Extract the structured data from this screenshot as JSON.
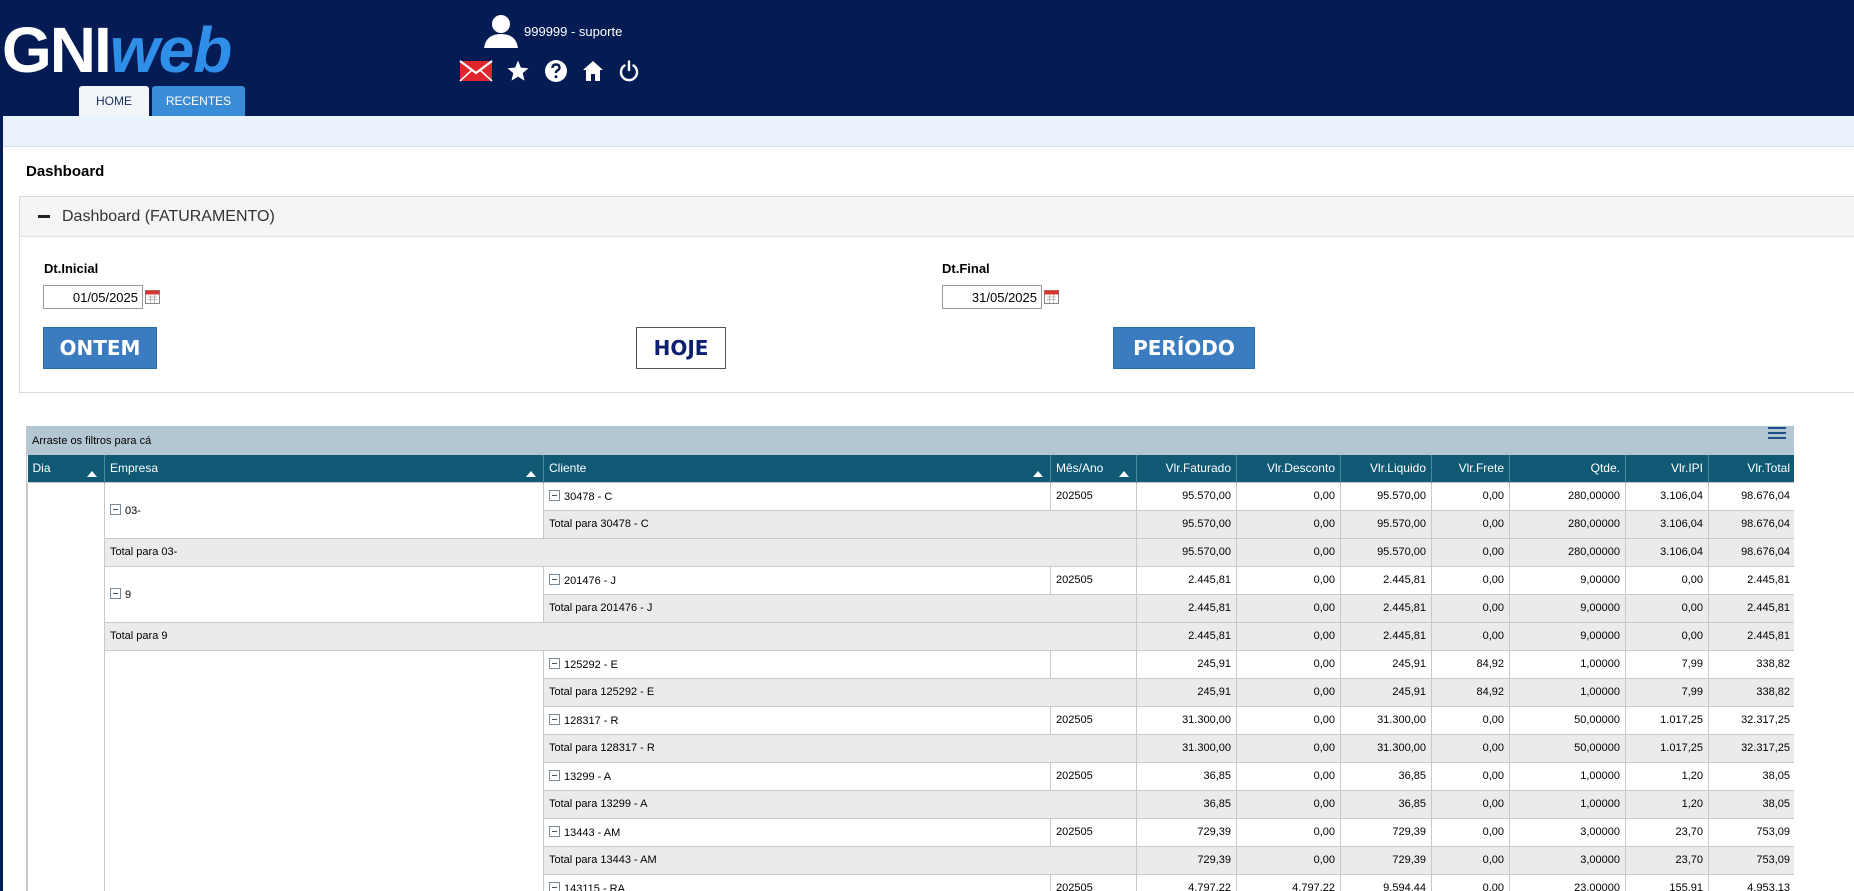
{
  "header": {
    "logo_part1": "GNI",
    "logo_part2": "web",
    "user": "999999 - suporte",
    "toolbar_icons": [
      "mail-icon",
      "star-icon",
      "help-icon",
      "home-icon",
      "power-icon"
    ],
    "tabs": [
      {
        "label": "HOME"
      },
      {
        "label": "RECENTES"
      }
    ]
  },
  "page": {
    "title": "Dashboard",
    "panel_title": "Dashboard (FATURAMENTO)"
  },
  "filters": {
    "dt_inicial_label": "Dt.Inicial",
    "dt_inicial_value": "01/05/2025",
    "dt_final_label": "Dt.Final",
    "dt_final_value": "31/05/2025",
    "btn_ontem": "ONTEM",
    "btn_hoje": "HOJE",
    "btn_periodo": "PERÍODO"
  },
  "grid": {
    "filter_hint": "Arraste os filtros para cá",
    "columns": [
      "Dia",
      "Empresa",
      "Cliente",
      "Mês/Ano",
      "Vlr.Faturado",
      "Vlr.Desconto",
      "Vlr.Liquido",
      "Vlr.Frete",
      "Qtde.",
      "Vlr.IPI",
      "Vlr.Total"
    ],
    "groups": [
      {
        "empresa": "03-",
        "clientes": [
          {
            "cliente": "30478 - C",
            "mes_ano": "202505",
            "values": [
              "95.570,00",
              "0,00",
              "95.570,00",
              "0,00",
              "280,00000",
              "3.106,04",
              "98.676,04"
            ],
            "total_label": "Total para 30478 - C",
            "total_values": [
              "95.570,00",
              "0,00",
              "95.570,00",
              "0,00",
              "280,00000",
              "3.106,04",
              "98.676,04"
            ]
          }
        ],
        "total_label": "Total para 03-",
        "total_values": [
          "95.570,00",
          "0,00",
          "95.570,00",
          "0,00",
          "280,00000",
          "3.106,04",
          "98.676,04"
        ]
      },
      {
        "empresa": "9",
        "clientes": [
          {
            "cliente": "201476 - J",
            "mes_ano": "202505",
            "values": [
              "2.445,81",
              "0,00",
              "2.445,81",
              "0,00",
              "9,00000",
              "0,00",
              "2.445,81"
            ],
            "total_label": "Total para 201476 - J",
            "total_values": [
              "2.445,81",
              "0,00",
              "2.445,81",
              "0,00",
              "9,00000",
              "0,00",
              "2.445,81"
            ]
          }
        ],
        "total_label": "Total para 9",
        "total_values": [
          "2.445,81",
          "0,00",
          "2.445,81",
          "0,00",
          "9,00000",
          "0,00",
          "2.445,81"
        ]
      },
      {
        "empresa": "",
        "clientes": [
          {
            "cliente": "125292 - E",
            "mes_ano": "",
            "values": [
              "245,91",
              "0,00",
              "245,91",
              "84,92",
              "1,00000",
              "7,99",
              "338,82"
            ],
            "total_label": "Total para 125292 - E",
            "total_values": [
              "245,91",
              "0,00",
              "245,91",
              "84,92",
              "1,00000",
              "7,99",
              "338,82"
            ]
          },
          {
            "cliente": "128317 - R",
            "mes_ano": "202505",
            "values": [
              "31.300,00",
              "0,00",
              "31.300,00",
              "0,00",
              "50,00000",
              "1.017,25",
              "32.317,25"
            ],
            "total_label": "Total para 128317 - R",
            "total_values": [
              "31.300,00",
              "0,00",
              "31.300,00",
              "0,00",
              "50,00000",
              "1.017,25",
              "32.317,25"
            ]
          },
          {
            "cliente": "13299 - A",
            "mes_ano": "202505",
            "values": [
              "36,85",
              "0,00",
              "36,85",
              "0,00",
              "1,00000",
              "1,20",
              "38,05"
            ],
            "total_label": "Total para 13299 - A",
            "total_values": [
              "36,85",
              "0,00",
              "36,85",
              "0,00",
              "1,00000",
              "1,20",
              "38,05"
            ]
          },
          {
            "cliente": "13443 - AM",
            "mes_ano": "202505",
            "values": [
              "729,39",
              "0,00",
              "729,39",
              "0,00",
              "3,00000",
              "23,70",
              "753,09"
            ],
            "total_label": "Total para 13443 - AM",
            "total_values": [
              "729,39",
              "0,00",
              "729,39",
              "0,00",
              "3,00000",
              "23,70",
              "753,09"
            ]
          },
          {
            "cliente": "143115 - RA",
            "mes_ano": "202505",
            "values": [
              "4.797,22",
              "4.797,22",
              "9.594,44",
              "0,00",
              "23,00000",
              "155,91",
              "4.953,13"
            ],
            "total_label": "",
            "total_values": []
          }
        ],
        "total_label": "",
        "total_values": []
      }
    ]
  },
  "colors": {
    "header_bg": "#051b54",
    "grid_header_bg": "#0f5975",
    "accent_blue": "#3b7bbf"
  }
}
